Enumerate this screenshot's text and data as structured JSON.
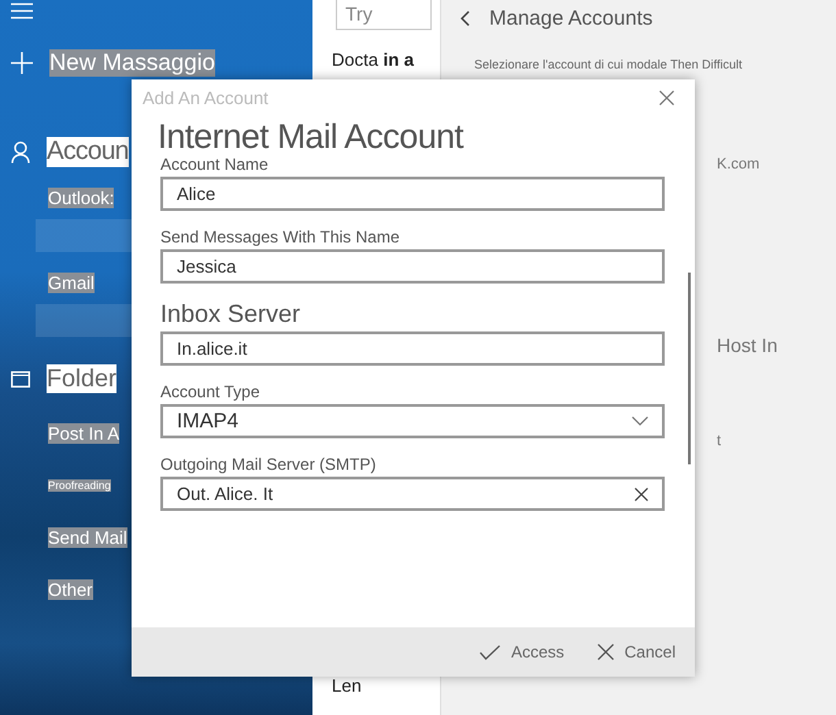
{
  "sidebar": {
    "new_message": "New Massaggio",
    "accounts_heading": "Accoun",
    "accounts": [
      {
        "name": "Outlook:"
      },
      {
        "name": "Gmail"
      }
    ],
    "folders_heading": "Folder",
    "folders": [
      "Post In A",
      "Proofreading",
      "Send Mail",
      "Other"
    ]
  },
  "message_list": {
    "search": {
      "placeholder": "Try"
    },
    "items": [
      "Docta **in a**",
      "Len"
    ]
  },
  "manage_accounts": {
    "title": "Manage Accounts",
    "instruction": "Selezionare l'account di cui modale Then Difficult",
    "fragments": [
      "K.com",
      "Host In",
      "t"
    ]
  },
  "dialog": {
    "title": "Add An Account",
    "heading": "Internet Mail Account",
    "fields": [
      {
        "kind": "text",
        "label": "Account Name",
        "value": "Alice",
        "large_label": false
      },
      {
        "kind": "text",
        "label": "Send Messages With This Name",
        "value": "Jessica",
        "large_label": false
      },
      {
        "kind": "text",
        "label": "Inbox Server",
        "value": "In.alice.it",
        "large_label": true
      },
      {
        "kind": "select",
        "label": "Account Type",
        "value": "IMAP4",
        "large_label": false
      },
      {
        "kind": "clearable",
        "label": "Outgoing Mail Server (SMTP)",
        "value": "Out. Alice. It",
        "large_label": false
      }
    ],
    "buttons": [
      {
        "kind": "confirm",
        "label": "Access"
      },
      {
        "kind": "cancel",
        "label": "Cancel"
      }
    ]
  }
}
